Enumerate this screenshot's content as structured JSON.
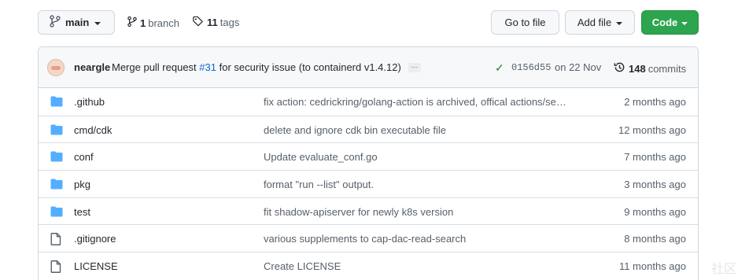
{
  "toolbar": {
    "branch_button": {
      "label": "main"
    },
    "branch_count": "1",
    "branch_label": "branch",
    "tag_count": "11",
    "tag_label": "tags",
    "go_to_file": "Go to file",
    "add_file": "Add file",
    "code": "Code"
  },
  "commit": {
    "author": "neargle",
    "message_prefix": "Merge pull request ",
    "pr": "#31",
    "message_suffix": " for security issue (to containerd v1.4.12)",
    "ellipsis": "…",
    "sha": "0156d55",
    "date": "on 22 Nov",
    "commit_count": "148",
    "commit_label": "commits"
  },
  "files": [
    {
      "type": "folder",
      "name": ".github",
      "message": "fix action: cedrickring/golang-action is archived, offical actions/se…",
      "age": "2 months ago"
    },
    {
      "type": "folder",
      "name": "cmd/cdk",
      "message": "delete and ignore cdk bin executable file",
      "age": "12 months ago"
    },
    {
      "type": "folder",
      "name": "conf",
      "message": "Update evaluate_conf.go",
      "age": "7 months ago"
    },
    {
      "type": "folder",
      "name": "pkg",
      "message": "format \"run --list\" output.",
      "age": "3 months ago"
    },
    {
      "type": "folder",
      "name": "test",
      "message": "fit shadow-apiserver for newly k8s version",
      "age": "9 months ago"
    },
    {
      "type": "file",
      "name": ".gitignore",
      "message": "various supplements to cap-dac-read-search",
      "age": "8 months ago"
    },
    {
      "type": "file",
      "name": "LICENSE",
      "message": "Create LICENSE",
      "age": "11 months ago"
    }
  ],
  "watermark": "社区",
  "colors": {
    "folder": "#54aeff",
    "code_button": "#2da44e",
    "link": "#0969da",
    "check": "#1a7f37"
  }
}
